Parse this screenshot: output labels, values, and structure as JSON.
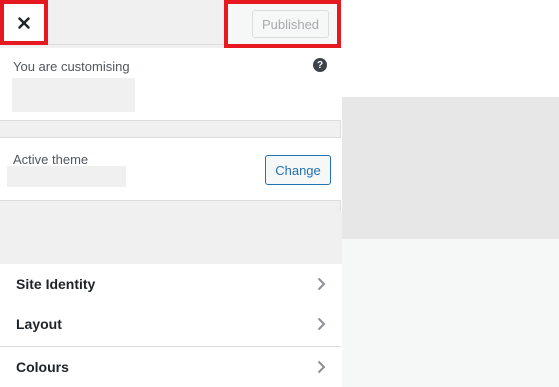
{
  "header": {
    "close_icon": "close-icon",
    "publish_label": "Published"
  },
  "info": {
    "customising_label": "You are customising",
    "help_icon_glyph": "?"
  },
  "theme": {
    "active_theme_label": "Active theme",
    "change_label": "Change"
  },
  "menu": {
    "items": [
      {
        "label": "Site Identity",
        "icon": "chevron-right-icon"
      },
      {
        "label": "Layout",
        "icon": "chevron-right-icon"
      },
      {
        "label": "Colours",
        "icon": "chevron-right-icon"
      }
    ]
  },
  "colors": {
    "highlight_border": "#e5191f",
    "accent": "#2271b1",
    "panel_bg": "#f0f0f1"
  }
}
